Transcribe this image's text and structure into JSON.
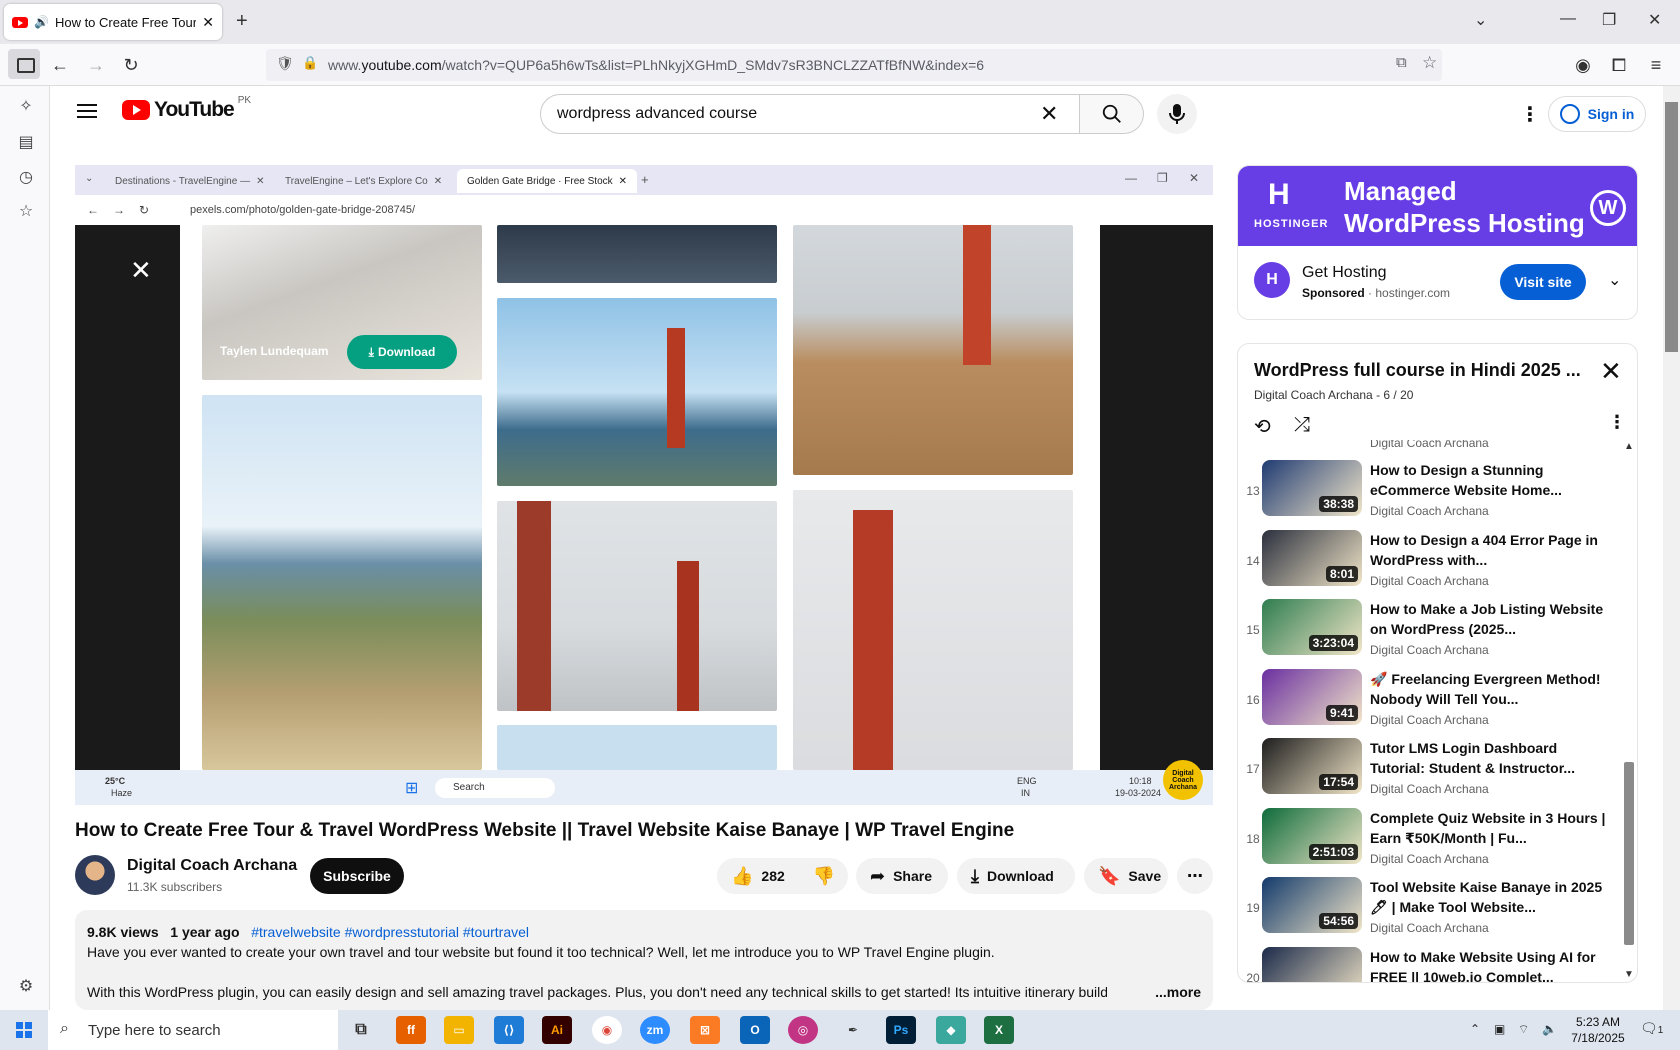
{
  "browser": {
    "tab_title": "How to Create Free Tour &",
    "url_prefix": "www.",
    "url_host": "youtube.com",
    "url_path": "/watch?v=QUP6a5h6wTs&list=PLhNkyjXGHmD_SMdv7sR3BNCLZZATfBfNW&index=6"
  },
  "header": {
    "logo_text": "YouTube",
    "country_code": "PK",
    "search_value": "wordpress advanced course",
    "signin_label": "Sign in"
  },
  "player": {
    "tabs": [
      "Destinations - TravelEngine —",
      "TravelEngine – Let's Explore Co",
      "Golden Gate Bridge · Free Stock"
    ],
    "url": "pexels.com/photo/golden-gate-bridge-208745/",
    "photographer": "Taylen Lundequam",
    "download_label": "Download",
    "taskbar_search": "Search",
    "weather_temp": "25°C",
    "weather_desc": "Haze",
    "lang": "ENG",
    "lang_region": "IN",
    "time": "10:18",
    "date": "19-03-2024",
    "badge_text": "Digital Coach Archana"
  },
  "video": {
    "title": "How to Create Free Tour & Travel WordPress Website || Travel Website Kaise Banaye | WP Travel Engine",
    "channel": "Digital Coach Archana",
    "subscribers": "11.3K subscribers",
    "subscribe_label": "Subscribe",
    "likes": "282",
    "share_label": "Share",
    "download_label": "Download",
    "save_label": "Save",
    "views": "9.8K views",
    "age": "1 year ago",
    "tags": "#travelwebsite #wordpresstutorial #tourtravel",
    "desc_line1": "Have you ever wanted to create your own travel and tour website but found it too technical? Well, let me introduce you to WP Travel Engine plugin.",
    "desc_line2": "With this WordPress plugin, you can easily design and sell amazing travel packages. Plus, you don't need any technical skills to get started! Its intuitive itinerary builder helps",
    "more_label": "...more"
  },
  "ad": {
    "banner_line1": "Managed",
    "banner_line2": "WordPress Hosting",
    "brand": "HOSTINGER",
    "title": "Get Hosting",
    "sponsored": "Sponsored",
    "domain": "hostinger.com",
    "visit_label": "Visit site"
  },
  "playlist": {
    "title": "WordPress full course in Hindi 2025 ...",
    "subtitle": "Digital Coach Archana - 6 / 20",
    "partial_top_channel": "Digital Coach Archana",
    "items": [
      {
        "num": "13",
        "title": "How to Design a Stunning eCommerce Website Home...",
        "channel": "Digital Coach Archana",
        "duration": "38:38",
        "thumb": "#1f3b73"
      },
      {
        "num": "14",
        "title": "How to Design a 404 Error Page in WordPress with...",
        "channel": "Digital Coach Archana",
        "duration": "8:01",
        "thumb": "#2a2f3d"
      },
      {
        "num": "15",
        "title": "How to Make a Job Listing Website on WordPress (2025...",
        "channel": "Digital Coach Archana",
        "duration": "3:23:04",
        "thumb": "#2e7d4f"
      },
      {
        "num": "16",
        "title": "🚀 Freelancing Evergreen Method! Nobody Will Tell You...",
        "channel": "Digital Coach Archana",
        "duration": "9:41",
        "thumb": "#6a2fa0"
      },
      {
        "num": "17",
        "title": "Tutor LMS Login Dashboard Tutorial: Student & Instructor...",
        "channel": "Digital Coach Archana",
        "duration": "17:54",
        "thumb": "#1d1d1d"
      },
      {
        "num": "18",
        "title": "Complete Quiz Website in 3 Hours | Earn ₹50K/Month | Fu...",
        "channel": "Digital Coach Archana",
        "duration": "2:51:03",
        "thumb": "#0d6b3a"
      },
      {
        "num": "19",
        "title": "Tool Website Kaise Banaye in 2025 🖊 | Make Tool Website...",
        "channel": "Digital Coach Archana",
        "duration": "54:56",
        "thumb": "#123a6b"
      },
      {
        "num": "20",
        "title": "How to Make Website Using AI for FREE || 10web.io Complet...",
        "channel": "",
        "duration": "",
        "thumb": "#1b2a4a"
      }
    ]
  },
  "taskbar": {
    "search_placeholder": "Type here to search",
    "time": "5:23 AM",
    "date": "7/18/2025",
    "notif_count": "1"
  }
}
